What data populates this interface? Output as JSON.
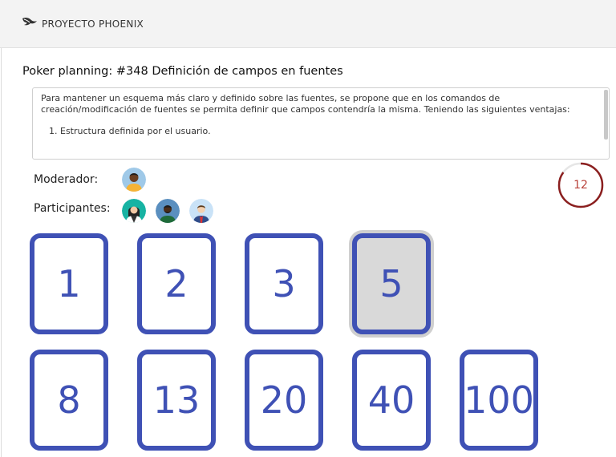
{
  "header": {
    "brand": "PROYECTO PHOENIX"
  },
  "task": {
    "title": "Poker planning: #348 Definición de campos en fuentes",
    "description": "Para mantener un esquema más claro y definido sobre las fuentes, se propone que en los comandos de creación/modificación de fuentes se permita definir que campos contendría la misma. Teniendo las siguientes ventajas:",
    "list": [
      "Estructura definida por el usuario."
    ]
  },
  "moderator_label": "Moderador:",
  "participants_label": "Participantes:",
  "timer": {
    "value": "12",
    "progress": 0.85,
    "color": "#8b1f1f"
  },
  "cards": [
    "1",
    "2",
    "3",
    "5",
    "8",
    "13",
    "20",
    "40",
    "100"
  ],
  "selected_card": "5",
  "colors": {
    "accent": "#3f51b5",
    "selected_bg": "#d9d9d9"
  }
}
